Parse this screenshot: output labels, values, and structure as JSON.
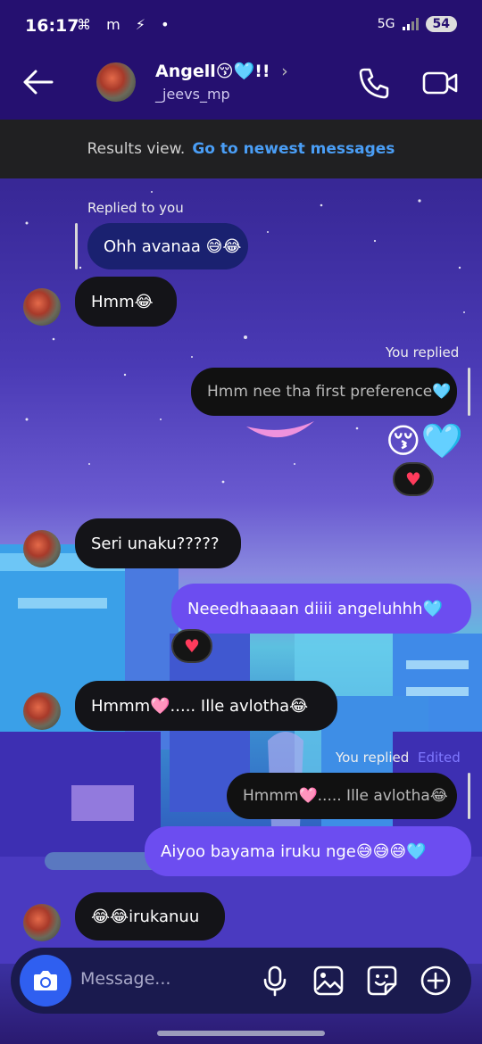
{
  "status": {
    "time": "16:17",
    "left_icons": "⌘ m ⚡ •",
    "network": "5G",
    "battery": "54"
  },
  "header": {
    "name": "Angell😚🩵!!",
    "username": "_jeevs_mp",
    "chevron": "›"
  },
  "banner": {
    "text": "Results view.",
    "link": "Go to newest messages"
  },
  "messages": [
    {
      "label": "Replied to you",
      "text": "Ohh avanaa 😅😂"
    },
    {
      "text": "Hmm😂"
    },
    {
      "label": "You replied",
      "quoted": "Hmm nee tha first preference🩵",
      "emoji": "😚🩵",
      "reaction": "♥"
    },
    {
      "text": "Seri unaku?????"
    },
    {
      "text": "Neeedhaaaan diiii angeluhhh🩵",
      "reaction": "♥"
    },
    {
      "text": "Hmmm🩷..... Ille avlotha😂"
    },
    {
      "label": "You replied",
      "edited": "Edited",
      "quoted": "Hmmm🩷..... Ille avlotha😂",
      "text": "Aiyoo bayama iruku nge😅😅😅🩵"
    },
    {
      "text": "😂😂irukanuu"
    }
  ],
  "composer": {
    "placeholder": "Message..."
  }
}
